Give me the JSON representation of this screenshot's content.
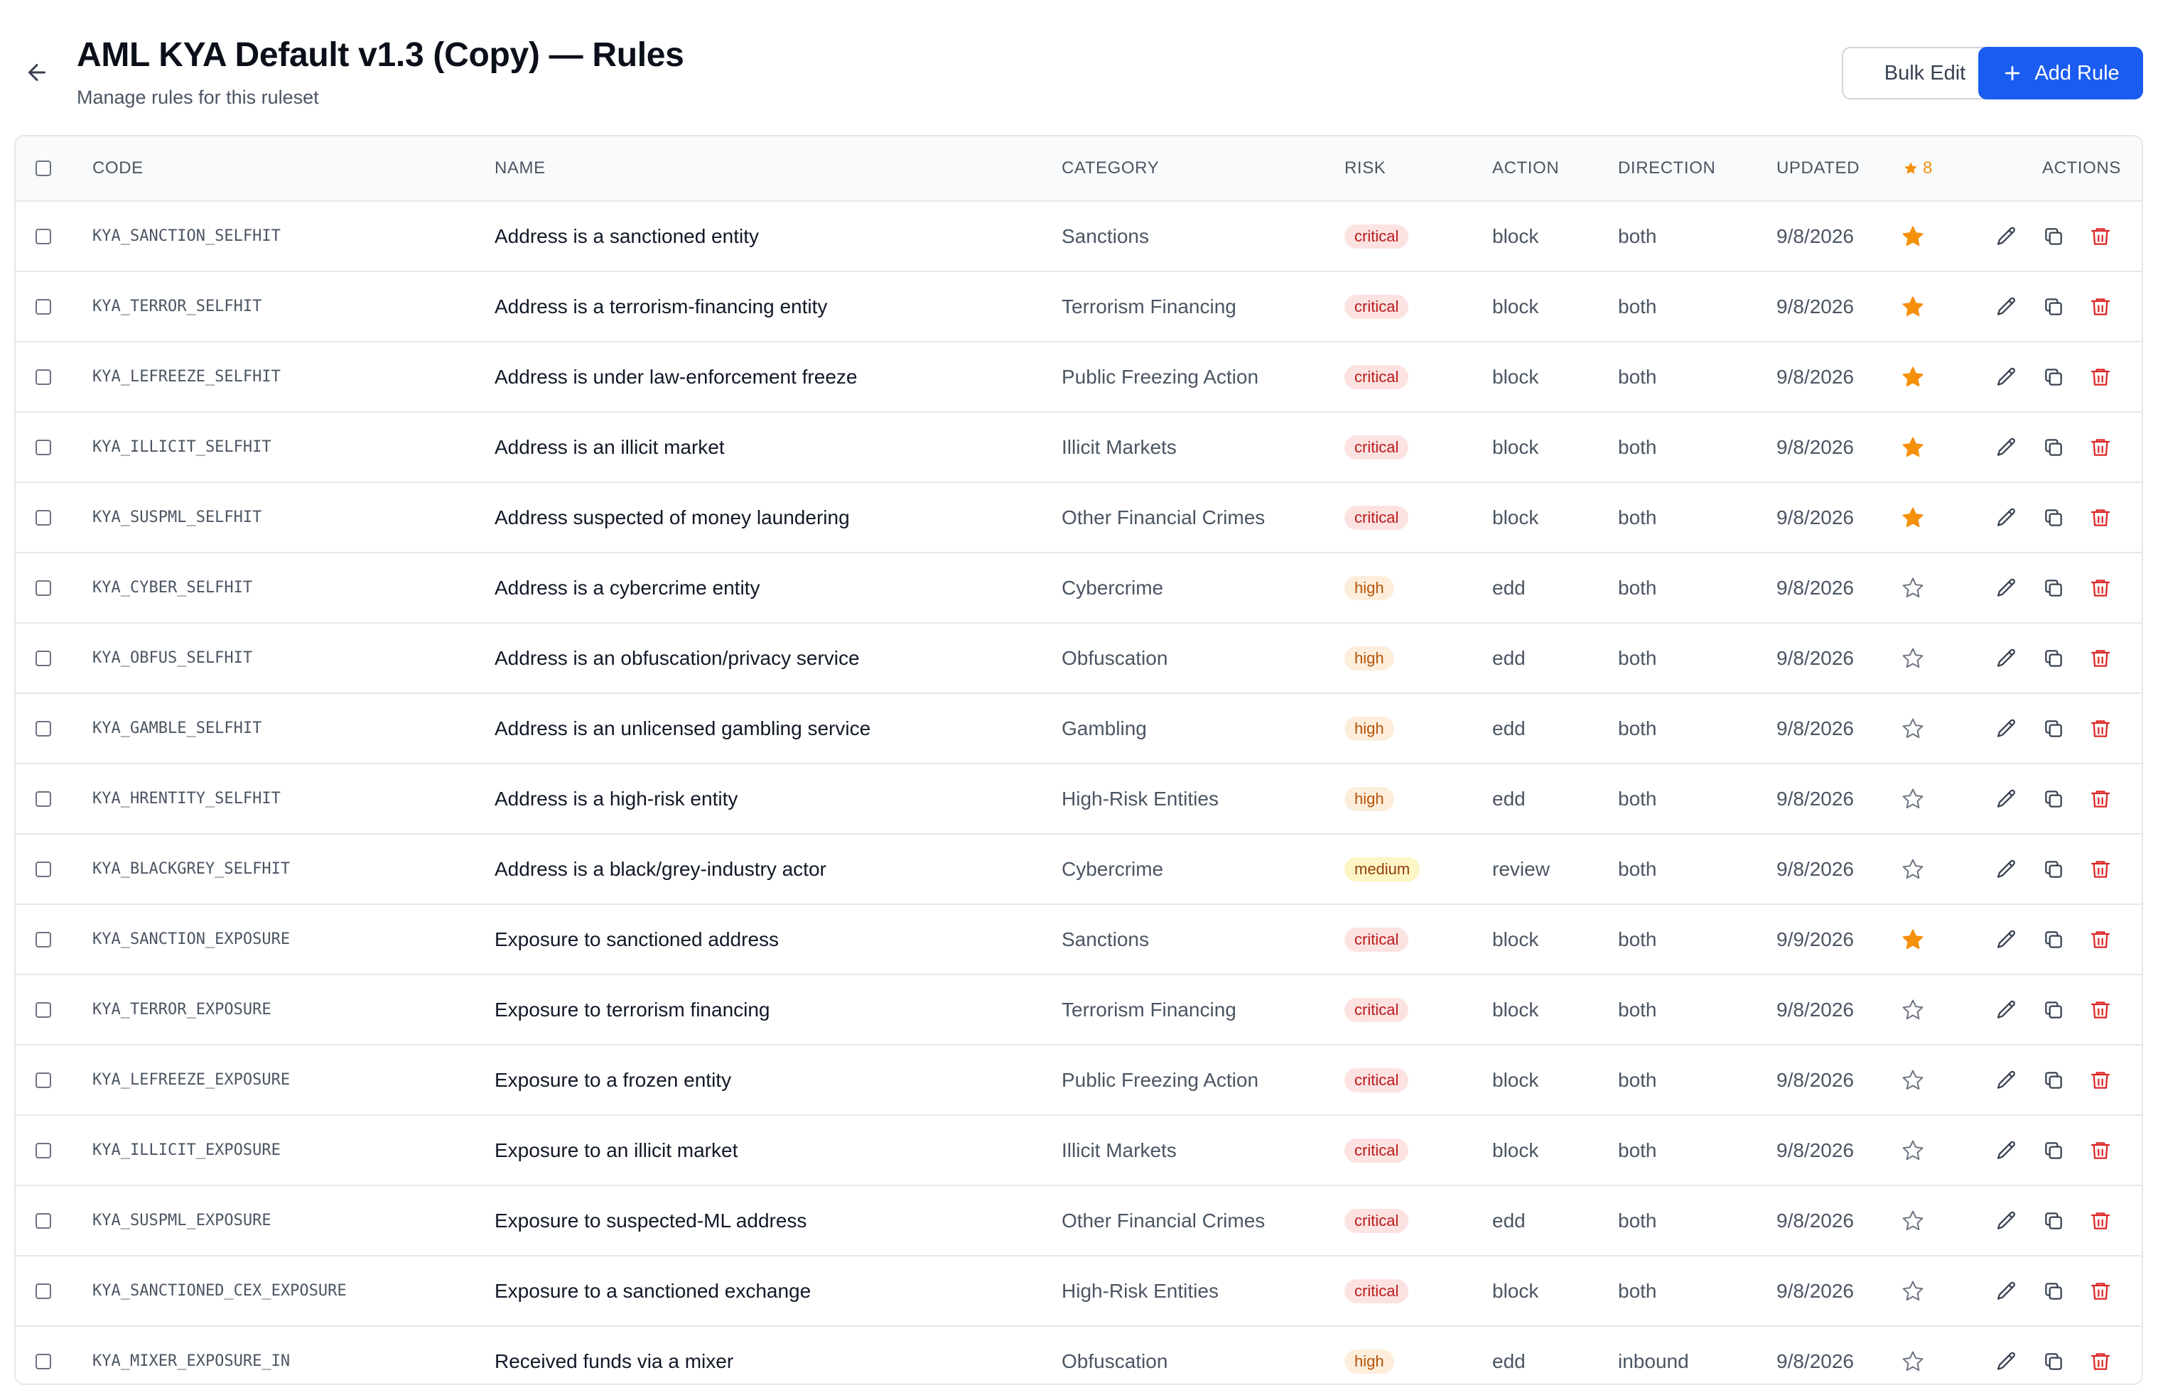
{
  "header": {
    "title": "AML KYA Default v1.3 (Copy) — Rules",
    "subtitle": "Manage rules for this ruleset",
    "bulk_edit_label": "Bulk Edit",
    "add_rule_label": "Add Rule"
  },
  "columns": {
    "code": "CODE",
    "name": "NAME",
    "category": "CATEGORY",
    "risk": "RISK",
    "action": "ACTION",
    "direction": "DIRECTION",
    "updated": "UPDATED",
    "starred_count": "8",
    "actions": "ACTIONS"
  },
  "colors": {
    "accent": "#1a5cf0",
    "star": "#f5900b",
    "delete": "#dc2626"
  },
  "rows": [
    {
      "code": "KYA_SANCTION_SELFHIT",
      "name": "Address is a sanctioned entity",
      "category": "Sanctions",
      "risk": "critical",
      "action": "block",
      "direction": "both",
      "updated": "9/8/2026",
      "starred": true
    },
    {
      "code": "KYA_TERROR_SELFHIT",
      "name": "Address is a terrorism-financing entity",
      "category": "Terrorism Financing",
      "risk": "critical",
      "action": "block",
      "direction": "both",
      "updated": "9/8/2026",
      "starred": true
    },
    {
      "code": "KYA_LEFREEZE_SELFHIT",
      "name": "Address is under law-enforcement freeze",
      "category": "Public Freezing Action",
      "risk": "critical",
      "action": "block",
      "direction": "both",
      "updated": "9/8/2026",
      "starred": true
    },
    {
      "code": "KYA_ILLICIT_SELFHIT",
      "name": "Address is an illicit market",
      "category": "Illicit Markets",
      "risk": "critical",
      "action": "block",
      "direction": "both",
      "updated": "9/8/2026",
      "starred": true
    },
    {
      "code": "KYA_SUSPML_SELFHIT",
      "name": "Address suspected of money laundering",
      "category": "Other Financial Crimes",
      "risk": "critical",
      "action": "block",
      "direction": "both",
      "updated": "9/8/2026",
      "starred": true
    },
    {
      "code": "KYA_CYBER_SELFHIT",
      "name": "Address is a cybercrime entity",
      "category": "Cybercrime",
      "risk": "high",
      "action": "edd",
      "direction": "both",
      "updated": "9/8/2026",
      "starred": false
    },
    {
      "code": "KYA_OBFUS_SELFHIT",
      "name": "Address is an obfuscation/privacy service",
      "category": "Obfuscation",
      "risk": "high",
      "action": "edd",
      "direction": "both",
      "updated": "9/8/2026",
      "starred": false
    },
    {
      "code": "KYA_GAMBLE_SELFHIT",
      "name": "Address is an unlicensed gambling service",
      "category": "Gambling",
      "risk": "high",
      "action": "edd",
      "direction": "both",
      "updated": "9/8/2026",
      "starred": false
    },
    {
      "code": "KYA_HRENTITY_SELFHIT",
      "name": "Address is a high-risk entity",
      "category": "High-Risk Entities",
      "risk": "high",
      "action": "edd",
      "direction": "both",
      "updated": "9/8/2026",
      "starred": false
    },
    {
      "code": "KYA_BLACKGREY_SELFHIT",
      "name": "Address is a black/grey-industry actor",
      "category": "Cybercrime",
      "risk": "medium",
      "action": "review",
      "direction": "both",
      "updated": "9/8/2026",
      "starred": false
    },
    {
      "code": "KYA_SANCTION_EXPOSURE",
      "name": "Exposure to sanctioned address",
      "category": "Sanctions",
      "risk": "critical",
      "action": "block",
      "direction": "both",
      "updated": "9/9/2026",
      "starred": true
    },
    {
      "code": "KYA_TERROR_EXPOSURE",
      "name": "Exposure to terrorism financing",
      "category": "Terrorism Financing",
      "risk": "critical",
      "action": "block",
      "direction": "both",
      "updated": "9/8/2026",
      "starred": false
    },
    {
      "code": "KYA_LEFREEZE_EXPOSURE",
      "name": "Exposure to a frozen entity",
      "category": "Public Freezing Action",
      "risk": "critical",
      "action": "block",
      "direction": "both",
      "updated": "9/8/2026",
      "starred": false
    },
    {
      "code": "KYA_ILLICIT_EXPOSURE",
      "name": "Exposure to an illicit market",
      "category": "Illicit Markets",
      "risk": "critical",
      "action": "block",
      "direction": "both",
      "updated": "9/8/2026",
      "starred": false
    },
    {
      "code": "KYA_SUSPML_EXPOSURE",
      "name": "Exposure to suspected-ML address",
      "category": "Other Financial Crimes",
      "risk": "critical",
      "action": "edd",
      "direction": "both",
      "updated": "9/8/2026",
      "starred": false
    },
    {
      "code": "KYA_SANCTIONED_CEX_EXPOSURE",
      "name": "Exposure to a sanctioned exchange",
      "category": "High-Risk Entities",
      "risk": "critical",
      "action": "block",
      "direction": "both",
      "updated": "9/8/2026",
      "starred": false
    },
    {
      "code": "KYA_MIXER_EXPOSURE_IN",
      "name": "Received funds via a mixer",
      "category": "Obfuscation",
      "risk": "high",
      "action": "edd",
      "direction": "inbound",
      "updated": "9/8/2026",
      "starred": false
    }
  ]
}
